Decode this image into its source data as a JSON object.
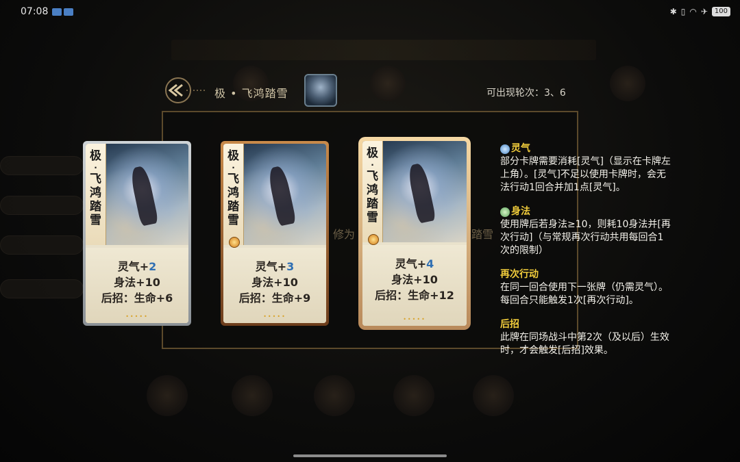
{
  "status": {
    "time": "07:08",
    "battery": "100"
  },
  "header": {
    "card_name": "极 • 飞鸿踏雪",
    "rounds": "可出现轮次：3、6"
  },
  "background_text": {
    "left_fragment": "修为",
    "right_fragment": "踏雪"
  },
  "cards": [
    {
      "name_chars": [
        "极",
        "·",
        "飞",
        "鸿",
        "踏",
        "雪"
      ],
      "aura_label": "灵气+",
      "aura_value": "2",
      "agility": "身法+10",
      "after": "后招：生命+6",
      "frame": "silver"
    },
    {
      "name_chars": [
        "极",
        "·",
        "飞",
        "鸿",
        "踏",
        "雪"
      ],
      "aura_label": "灵气+",
      "aura_value": "3",
      "agility": "身法+10",
      "after": "后招：生命+9",
      "frame": "bronze"
    },
    {
      "name_chars": [
        "极",
        "·",
        "飞",
        "鸿",
        "踏",
        "雪"
      ],
      "aura_label": "灵气+",
      "aura_value": "4",
      "agility": "身法+10",
      "after": "后招：生命+12",
      "frame": "gold"
    }
  ],
  "glossary": [
    {
      "title": "灵气",
      "icon": "aura-icon",
      "body": "部分卡牌需要消耗[灵气]（显示在卡牌左上角）。[灵气]不足以使用卡牌时，会无法行动1回合并加1点[灵气]。"
    },
    {
      "title": "身法",
      "icon": "agility-icon",
      "body": "使用牌后若身法≥10，则耗10身法并[再次行动]（与常规再次行动共用每回合1次的限制）"
    },
    {
      "title": "再次行动",
      "icon": "",
      "body": "在同一回合使用下一张牌（仍需灵气）。每回合只能触发1次[再次行动]。"
    },
    {
      "title": "后招",
      "icon": "",
      "body": "此牌在同场战斗中第2次（及以后）生效时，才会触发[后招]效果。"
    }
  ],
  "colors": {
    "highlight_title": "#f1cc3b",
    "value_blue": "#2f6fb3",
    "panel_border": "#5c4a2b"
  }
}
